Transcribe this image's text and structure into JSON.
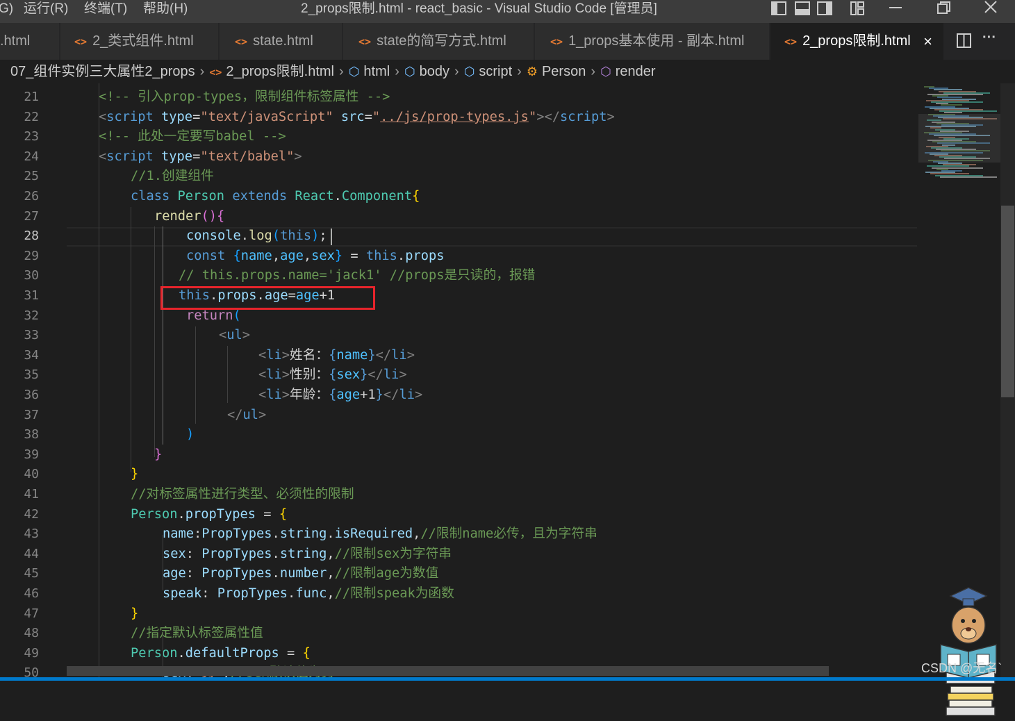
{
  "titlebar": {
    "menu": [
      "G)",
      "运行(R)",
      "终端(T)",
      "帮助(H)"
    ],
    "title": "2_props限制.html - react_basic - Visual Studio Code [管理员]"
  },
  "tabs": [
    {
      "label": ".html",
      "active": false
    },
    {
      "label": "2_类式组件.html",
      "active": false
    },
    {
      "label": "state.html",
      "active": false
    },
    {
      "label": "state的简写方式.html",
      "active": false
    },
    {
      "label": "1_props基本使用 - 副本.html",
      "active": false
    },
    {
      "label": "2_props限制.html",
      "active": true
    }
  ],
  "tab_actions": {
    "close": "×",
    "split": "split-editor-icon",
    "more": "···"
  },
  "breadcrumb": {
    "folder": "07_组件实例三大属性2_props",
    "file": "2_props限制.html",
    "items": [
      "html",
      "body",
      "script",
      "Person",
      "render"
    ]
  },
  "editor": {
    "current_line": 28,
    "highlighted_line": 31,
    "lines": [
      {
        "n": 21,
        "tokens": [
          [
            "c-com",
            "<!-- 引入prop-types，限制组件标签属性 -->"
          ]
        ]
      },
      {
        "n": 22,
        "tokens": [
          [
            "c-br",
            "<"
          ],
          [
            "c-tag",
            "script"
          ],
          [
            "c-txt",
            " "
          ],
          [
            "c-attr",
            "type"
          ],
          [
            "c-txt",
            "="
          ],
          [
            "c-str",
            "\"text/javaScript\""
          ],
          [
            "c-txt",
            " "
          ],
          [
            "c-attr",
            "src"
          ],
          [
            "c-txt",
            "="
          ],
          [
            "c-str",
            "\""
          ],
          [
            "c-link",
            "../js/prop-types.js"
          ],
          [
            "c-str",
            "\""
          ],
          [
            "c-br",
            "></"
          ],
          [
            "c-tag",
            "script"
          ],
          [
            "c-br",
            ">"
          ]
        ]
      },
      {
        "n": 23,
        "tokens": [
          [
            "c-com",
            "<!-- 此处一定要写babel -->"
          ]
        ]
      },
      {
        "n": 24,
        "tokens": [
          [
            "c-br",
            "<"
          ],
          [
            "c-tag",
            "script"
          ],
          [
            "c-txt",
            " "
          ],
          [
            "c-attr",
            "type"
          ],
          [
            "c-txt",
            "="
          ],
          [
            "c-str",
            "\"text/babel\""
          ],
          [
            "c-br",
            ">"
          ]
        ]
      },
      {
        "n": 25,
        "tokens": [
          [
            "c-com",
            "//1.创建组件"
          ]
        ]
      },
      {
        "n": 26,
        "tokens": [
          [
            "c-kw",
            "class"
          ],
          [
            "c-txt",
            " "
          ],
          [
            "c-cls",
            "Person"
          ],
          [
            "c-txt",
            " "
          ],
          [
            "c-kw",
            "extends"
          ],
          [
            "c-txt",
            " "
          ],
          [
            "c-cls",
            "React"
          ],
          [
            "c-txt",
            "."
          ],
          [
            "c-cls",
            "Component"
          ],
          [
            "c-y",
            "{"
          ]
        ]
      },
      {
        "n": 27,
        "tokens": [
          [
            "c-fn",
            "render"
          ],
          [
            "c-p",
            "()"
          ],
          [
            "c-p",
            "{"
          ]
        ]
      },
      {
        "n": 28,
        "tokens": [
          [
            "c-var",
            "console"
          ],
          [
            "c-txt",
            "."
          ],
          [
            "c-fn",
            "log"
          ],
          [
            "c-b",
            "("
          ],
          [
            "c-kw",
            "this"
          ],
          [
            "c-b",
            ")"
          ],
          [
            "c-txt",
            ";"
          ]
        ]
      },
      {
        "n": 29,
        "tokens": [
          [
            "c-kw",
            "const"
          ],
          [
            "c-txt",
            " "
          ],
          [
            "c-b",
            "{"
          ],
          [
            "c-const",
            "name"
          ],
          [
            "c-txt",
            ","
          ],
          [
            "c-const",
            "age"
          ],
          [
            "c-txt",
            ","
          ],
          [
            "c-const",
            "sex"
          ],
          [
            "c-b",
            "}"
          ],
          [
            "c-txt",
            " = "
          ],
          [
            "c-kw",
            "this"
          ],
          [
            "c-txt",
            "."
          ],
          [
            "c-var",
            "props"
          ]
        ]
      },
      {
        "n": 30,
        "tokens": [
          [
            "c-com",
            "// this.props.name='jack1' //props是只读的，报错"
          ]
        ]
      },
      {
        "n": 31,
        "tokens": [
          [
            "c-kw",
            "this"
          ],
          [
            "c-txt",
            "."
          ],
          [
            "c-var",
            "props"
          ],
          [
            "c-txt",
            "."
          ],
          [
            "c-var",
            "age"
          ],
          [
            "c-txt",
            "="
          ],
          [
            "c-const",
            "age"
          ],
          [
            "c-txt",
            "+"
          ],
          [
            "c-txt",
            "1"
          ]
        ]
      },
      {
        "n": 32,
        "tokens": [
          [
            "c-kw2",
            "return"
          ],
          [
            "c-b",
            "("
          ]
        ]
      },
      {
        "n": 33,
        "tokens": [
          [
            "c-br",
            "<"
          ],
          [
            "c-tag",
            "ul"
          ],
          [
            "c-br",
            ">"
          ]
        ]
      },
      {
        "n": 34,
        "tokens": [
          [
            "c-br",
            "<"
          ],
          [
            "c-tag",
            "li"
          ],
          [
            "c-br",
            ">"
          ],
          [
            "c-txt",
            "姓名："
          ],
          [
            "c-kw",
            "{"
          ],
          [
            "c-const",
            "name"
          ],
          [
            "c-kw",
            "}"
          ],
          [
            "c-br",
            "</"
          ],
          [
            "c-tag",
            "li"
          ],
          [
            "c-br",
            ">"
          ]
        ]
      },
      {
        "n": 35,
        "tokens": [
          [
            "c-br",
            "<"
          ],
          [
            "c-tag",
            "li"
          ],
          [
            "c-br",
            ">"
          ],
          [
            "c-txt",
            "性别："
          ],
          [
            "c-kw",
            "{"
          ],
          [
            "c-const",
            "sex"
          ],
          [
            "c-kw",
            "}"
          ],
          [
            "c-br",
            "</"
          ],
          [
            "c-tag",
            "li"
          ],
          [
            "c-br",
            ">"
          ]
        ]
      },
      {
        "n": 36,
        "tokens": [
          [
            "c-br",
            "<"
          ],
          [
            "c-tag",
            "li"
          ],
          [
            "c-br",
            ">"
          ],
          [
            "c-txt",
            "年龄："
          ],
          [
            "c-kw",
            "{"
          ],
          [
            "c-const",
            "age"
          ],
          [
            "c-txt",
            "+1"
          ],
          [
            "c-kw",
            "}"
          ],
          [
            "c-br",
            "</"
          ],
          [
            "c-tag",
            "li"
          ],
          [
            "c-br",
            ">"
          ]
        ]
      },
      {
        "n": 37,
        "tokens": [
          [
            "c-br",
            "</"
          ],
          [
            "c-tag",
            "ul"
          ],
          [
            "c-br",
            ">"
          ]
        ]
      },
      {
        "n": 38,
        "tokens": [
          [
            "c-b",
            ")"
          ]
        ]
      },
      {
        "n": 39,
        "tokens": [
          [
            "c-p",
            "}"
          ]
        ]
      },
      {
        "n": 40,
        "tokens": [
          [
            "c-y",
            "}"
          ]
        ]
      },
      {
        "n": 41,
        "tokens": [
          [
            "c-com",
            "//对标签属性进行类型、必须性的限制"
          ]
        ]
      },
      {
        "n": 42,
        "tokens": [
          [
            "c-cls",
            "Person"
          ],
          [
            "c-txt",
            "."
          ],
          [
            "c-var",
            "propTypes"
          ],
          [
            "c-txt",
            " = "
          ],
          [
            "c-y",
            "{"
          ]
        ]
      },
      {
        "n": 43,
        "tokens": [
          [
            "c-var",
            "name"
          ],
          [
            "c-txt",
            ":"
          ],
          [
            "c-var",
            "PropTypes"
          ],
          [
            "c-txt",
            "."
          ],
          [
            "c-var",
            "string"
          ],
          [
            "c-txt",
            "."
          ],
          [
            "c-var",
            "isRequired"
          ],
          [
            "c-txt",
            ","
          ],
          [
            "c-com",
            "//限制name必传，且为字符串"
          ]
        ]
      },
      {
        "n": 44,
        "tokens": [
          [
            "c-var",
            "sex"
          ],
          [
            "c-txt",
            ": "
          ],
          [
            "c-var",
            "PropTypes"
          ],
          [
            "c-txt",
            "."
          ],
          [
            "c-var",
            "string"
          ],
          [
            "c-txt",
            ","
          ],
          [
            "c-com",
            "//限制sex为字符串"
          ]
        ]
      },
      {
        "n": 45,
        "tokens": [
          [
            "c-var",
            "age"
          ],
          [
            "c-txt",
            ": "
          ],
          [
            "c-var",
            "PropTypes"
          ],
          [
            "c-txt",
            "."
          ],
          [
            "c-var",
            "number"
          ],
          [
            "c-txt",
            ","
          ],
          [
            "c-com",
            "//限制age为数值"
          ]
        ]
      },
      {
        "n": 46,
        "tokens": [
          [
            "c-var",
            "speak"
          ],
          [
            "c-txt",
            ": "
          ],
          [
            "c-var",
            "PropTypes"
          ],
          [
            "c-txt",
            "."
          ],
          [
            "c-var",
            "func"
          ],
          [
            "c-txt",
            ","
          ],
          [
            "c-com",
            "//限制speak为函数"
          ]
        ]
      },
      {
        "n": 47,
        "tokens": [
          [
            "c-y",
            "}"
          ]
        ]
      },
      {
        "n": 48,
        "tokens": [
          [
            "c-com",
            "//指定默认标签属性值"
          ]
        ]
      },
      {
        "n": 49,
        "tokens": [
          [
            "c-cls",
            "Person"
          ],
          [
            "c-txt",
            "."
          ],
          [
            "c-var",
            "defaultProps"
          ],
          [
            "c-txt",
            " = "
          ],
          [
            "c-y",
            "{"
          ]
        ]
      },
      {
        "n": 50,
        "tokens": [
          [
            "c-var",
            "sex"
          ],
          [
            "c-txt",
            ":"
          ],
          [
            "c-str",
            "'男'"
          ],
          [
            "c-txt",
            ","
          ],
          [
            "c-com",
            "//sex默认值为男"
          ]
        ]
      }
    ]
  },
  "watermark": "CSDN @无名`"
}
